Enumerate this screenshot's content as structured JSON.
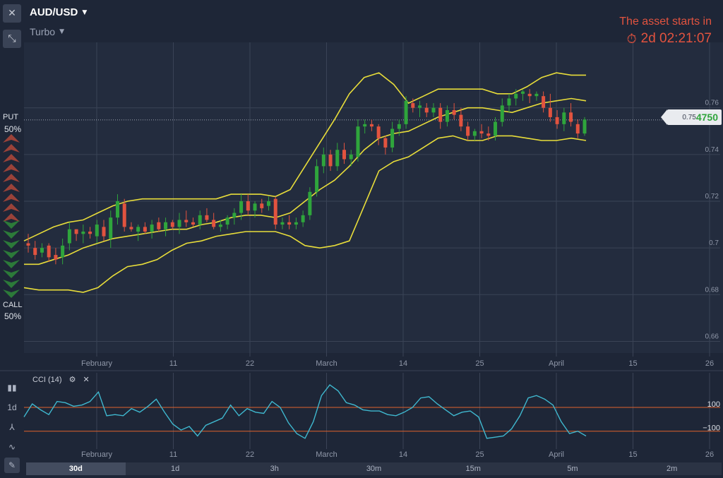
{
  "header": {
    "asset": "AUD/USD",
    "mode": "Turbo"
  },
  "countdown": {
    "label": "The asset starts in",
    "time": "2d 02:21:07"
  },
  "trade": {
    "put_label": "PUT",
    "put_pct": "50%",
    "call_label": "CALL",
    "call_pct": "50%"
  },
  "price": {
    "small": "0.75",
    "big": "4750",
    "value": 0.7548
  },
  "y_axis": {
    "ticks": [
      "0.76",
      "0.74",
      "0.72",
      "0.7",
      "0.68",
      "0.66"
    ],
    "values": [
      0.76,
      0.74,
      0.72,
      0.7,
      0.68,
      0.66
    ]
  },
  "x_axis": {
    "labels": [
      "February",
      "11",
      "22",
      "March",
      "14",
      "25",
      "April",
      "15",
      "26"
    ]
  },
  "indicator": {
    "name": "CCI (14)",
    "upper_label": "100",
    "lower_label": "−100",
    "upper": 100,
    "lower": -100,
    "values": [
      20,
      130,
      80,
      40,
      150,
      140,
      110,
      120,
      150,
      230,
      30,
      40,
      30,
      90,
      60,
      110,
      170,
      60,
      -40,
      -90,
      -60,
      -140,
      -50,
      -20,
      10,
      120,
      30,
      90,
      60,
      50,
      150,
      100,
      -30,
      -120,
      -160,
      -20,
      200,
      290,
      240,
      140,
      120,
      80,
      70,
      70,
      40,
      30,
      60,
      100,
      180,
      190,
      130,
      80,
      30,
      60,
      70,
      20,
      -160,
      -150,
      -140,
      -80,
      30,
      180,
      200,
      170,
      120,
      -20,
      -120,
      -100,
      -140
    ]
  },
  "chart_data": {
    "type": "candlestick",
    "x_labels": [
      "February",
      "11",
      "22",
      "March",
      "14",
      "25",
      "April",
      "15",
      "26"
    ],
    "ylim": [
      0.655,
      0.785
    ],
    "candles": [
      [
        0.702,
        0.706,
        0.698,
        0.701
      ],
      [
        0.7,
        0.703,
        0.695,
        0.697
      ],
      [
        0.698,
        0.702,
        0.696,
        0.7
      ],
      [
        0.701,
        0.702,
        0.694,
        0.696
      ],
      [
        0.697,
        0.7,
        0.693,
        0.695
      ],
      [
        0.696,
        0.704,
        0.693,
        0.701
      ],
      [
        0.702,
        0.711,
        0.699,
        0.708
      ],
      [
        0.708,
        0.708,
        0.703,
        0.706
      ],
      [
        0.706,
        0.71,
        0.702,
        0.707
      ],
      [
        0.707,
        0.709,
        0.704,
        0.706
      ],
      [
        0.705,
        0.712,
        0.702,
        0.71
      ],
      [
        0.709,
        0.712,
        0.703,
        0.705
      ],
      [
        0.704,
        0.716,
        0.7,
        0.713
      ],
      [
        0.713,
        0.723,
        0.71,
        0.72
      ],
      [
        0.719,
        0.721,
        0.707,
        0.709
      ],
      [
        0.709,
        0.711,
        0.707,
        0.708
      ],
      [
        0.707,
        0.71,
        0.703,
        0.709
      ],
      [
        0.709,
        0.711,
        0.706,
        0.707
      ],
      [
        0.707,
        0.712,
        0.704,
        0.71
      ],
      [
        0.711,
        0.713,
        0.707,
        0.708
      ],
      [
        0.708,
        0.713,
        0.705,
        0.711
      ],
      [
        0.711,
        0.712,
        0.708,
        0.709
      ],
      [
        0.709,
        0.715,
        0.706,
        0.712
      ],
      [
        0.712,
        0.716,
        0.709,
        0.711
      ],
      [
        0.711,
        0.713,
        0.709,
        0.71
      ],
      [
        0.71,
        0.716,
        0.708,
        0.714
      ],
      [
        0.714,
        0.717,
        0.711,
        0.712
      ],
      [
        0.712,
        0.715,
        0.708,
        0.709
      ],
      [
        0.709,
        0.712,
        0.707,
        0.71
      ],
      [
        0.71,
        0.714,
        0.708,
        0.713
      ],
      [
        0.713,
        0.717,
        0.71,
        0.715
      ],
      [
        0.715,
        0.723,
        0.712,
        0.72
      ],
      [
        0.72,
        0.723,
        0.714,
        0.716
      ],
      [
        0.716,
        0.72,
        0.713,
        0.719
      ],
      [
        0.719,
        0.721,
        0.715,
        0.717
      ],
      [
        0.718,
        0.722,
        0.716,
        0.72
      ],
      [
        0.721,
        0.722,
        0.708,
        0.71
      ],
      [
        0.71,
        0.713,
        0.708,
        0.711
      ],
      [
        0.711,
        0.714,
        0.708,
        0.71
      ],
      [
        0.71,
        0.713,
        0.708,
        0.711
      ],
      [
        0.711,
        0.716,
        0.709,
        0.714
      ],
      [
        0.714,
        0.726,
        0.712,
        0.724
      ],
      [
        0.724,
        0.738,
        0.722,
        0.735
      ],
      [
        0.735,
        0.743,
        0.732,
        0.74
      ],
      [
        0.74,
        0.742,
        0.733,
        0.735
      ],
      [
        0.735,
        0.745,
        0.733,
        0.742
      ],
      [
        0.742,
        0.745,
        0.736,
        0.738
      ],
      [
        0.738,
        0.742,
        0.735,
        0.74
      ],
      [
        0.739,
        0.755,
        0.737,
        0.752
      ],
      [
        0.752,
        0.755,
        0.749,
        0.753
      ],
      [
        0.753,
        0.755,
        0.75,
        0.752
      ],
      [
        0.752,
        0.753,
        0.744,
        0.747
      ],
      [
        0.747,
        0.748,
        0.74,
        0.743
      ],
      [
        0.743,
        0.754,
        0.741,
        0.751
      ],
      [
        0.751,
        0.755,
        0.748,
        0.753
      ],
      [
        0.753,
        0.765,
        0.751,
        0.763
      ],
      [
        0.762,
        0.764,
        0.758,
        0.76
      ],
      [
        0.76,
        0.763,
        0.756,
        0.761
      ],
      [
        0.76,
        0.762,
        0.756,
        0.758
      ],
      [
        0.758,
        0.762,
        0.756,
        0.76
      ],
      [
        0.76,
        0.762,
        0.751,
        0.754
      ],
      [
        0.754,
        0.761,
        0.752,
        0.759
      ],
      [
        0.759,
        0.762,
        0.755,
        0.757
      ],
      [
        0.757,
        0.76,
        0.75,
        0.752
      ],
      [
        0.752,
        0.754,
        0.746,
        0.748
      ],
      [
        0.748,
        0.751,
        0.746,
        0.75
      ],
      [
        0.75,
        0.753,
        0.747,
        0.749
      ],
      [
        0.749,
        0.752,
        0.746,
        0.748
      ],
      [
        0.748,
        0.756,
        0.746,
        0.754
      ],
      [
        0.754,
        0.764,
        0.752,
        0.761
      ],
      [
        0.761,
        0.766,
        0.758,
        0.764
      ],
      [
        0.764,
        0.768,
        0.761,
        0.766
      ],
      [
        0.766,
        0.768,
        0.763,
        0.767
      ],
      [
        0.766,
        0.768,
        0.762,
        0.765
      ],
      [
        0.765,
        0.767,
        0.763,
        0.766
      ],
      [
        0.765,
        0.767,
        0.758,
        0.76
      ],
      [
        0.76,
        0.766,
        0.754,
        0.756
      ],
      [
        0.756,
        0.759,
        0.751,
        0.753
      ],
      [
        0.753,
        0.76,
        0.75,
        0.758
      ],
      [
        0.758,
        0.762,
        0.752,
        0.754
      ],
      [
        0.753,
        0.755,
        0.747,
        0.749
      ],
      [
        0.749,
        0.756,
        0.748,
        0.755
      ]
    ],
    "bands": {
      "upper": [
        0.703,
        0.706,
        0.709,
        0.711,
        0.712,
        0.715,
        0.718,
        0.72,
        0.721,
        0.721,
        0.721,
        0.721,
        0.721,
        0.721,
        0.723,
        0.723,
        0.723,
        0.722,
        0.725,
        0.735,
        0.745,
        0.755,
        0.766,
        0.773,
        0.775,
        0.77,
        0.762,
        0.765,
        0.768,
        0.768,
        0.768,
        0.768,
        0.766,
        0.766,
        0.769,
        0.773,
        0.775,
        0.774,
        0.774
      ],
      "middle": [
        0.693,
        0.693,
        0.695,
        0.697,
        0.7,
        0.702,
        0.704,
        0.705,
        0.706,
        0.707,
        0.708,
        0.708,
        0.71,
        0.711,
        0.713,
        0.714,
        0.714,
        0.713,
        0.715,
        0.72,
        0.725,
        0.729,
        0.735,
        0.742,
        0.747,
        0.749,
        0.75,
        0.753,
        0.756,
        0.758,
        0.76,
        0.76,
        0.759,
        0.758,
        0.76,
        0.762,
        0.763,
        0.764,
        0.763
      ],
      "lower": [
        0.683,
        0.682,
        0.682,
        0.682,
        0.681,
        0.683,
        0.688,
        0.692,
        0.693,
        0.695,
        0.699,
        0.702,
        0.703,
        0.705,
        0.706,
        0.707,
        0.707,
        0.707,
        0.705,
        0.701,
        0.7,
        0.701,
        0.703,
        0.718,
        0.733,
        0.737,
        0.739,
        0.743,
        0.747,
        0.748,
        0.746,
        0.746,
        0.748,
        0.748,
        0.747,
        0.746,
        0.746,
        0.747,
        0.746
      ]
    },
    "series": [
      {
        "name": "",
        "values": []
      }
    ]
  },
  "tools": {
    "items": [
      "bar-chart-tool",
      "timeframe-1d-tool",
      "indicator-tool",
      "line-tool",
      "pen-tool"
    ],
    "tf_label": "1d"
  },
  "timeframes": {
    "items": [
      "30d",
      "1d",
      "3h",
      "30m",
      "15m",
      "5m",
      "2m"
    ],
    "active": "30d"
  },
  "colors": {
    "background": "#1e2637",
    "up": "#2fa53c",
    "down": "#e2533f",
    "bands": "#e8dd3a",
    "cci": "#3fb8cf",
    "levels": "#e0622c"
  }
}
